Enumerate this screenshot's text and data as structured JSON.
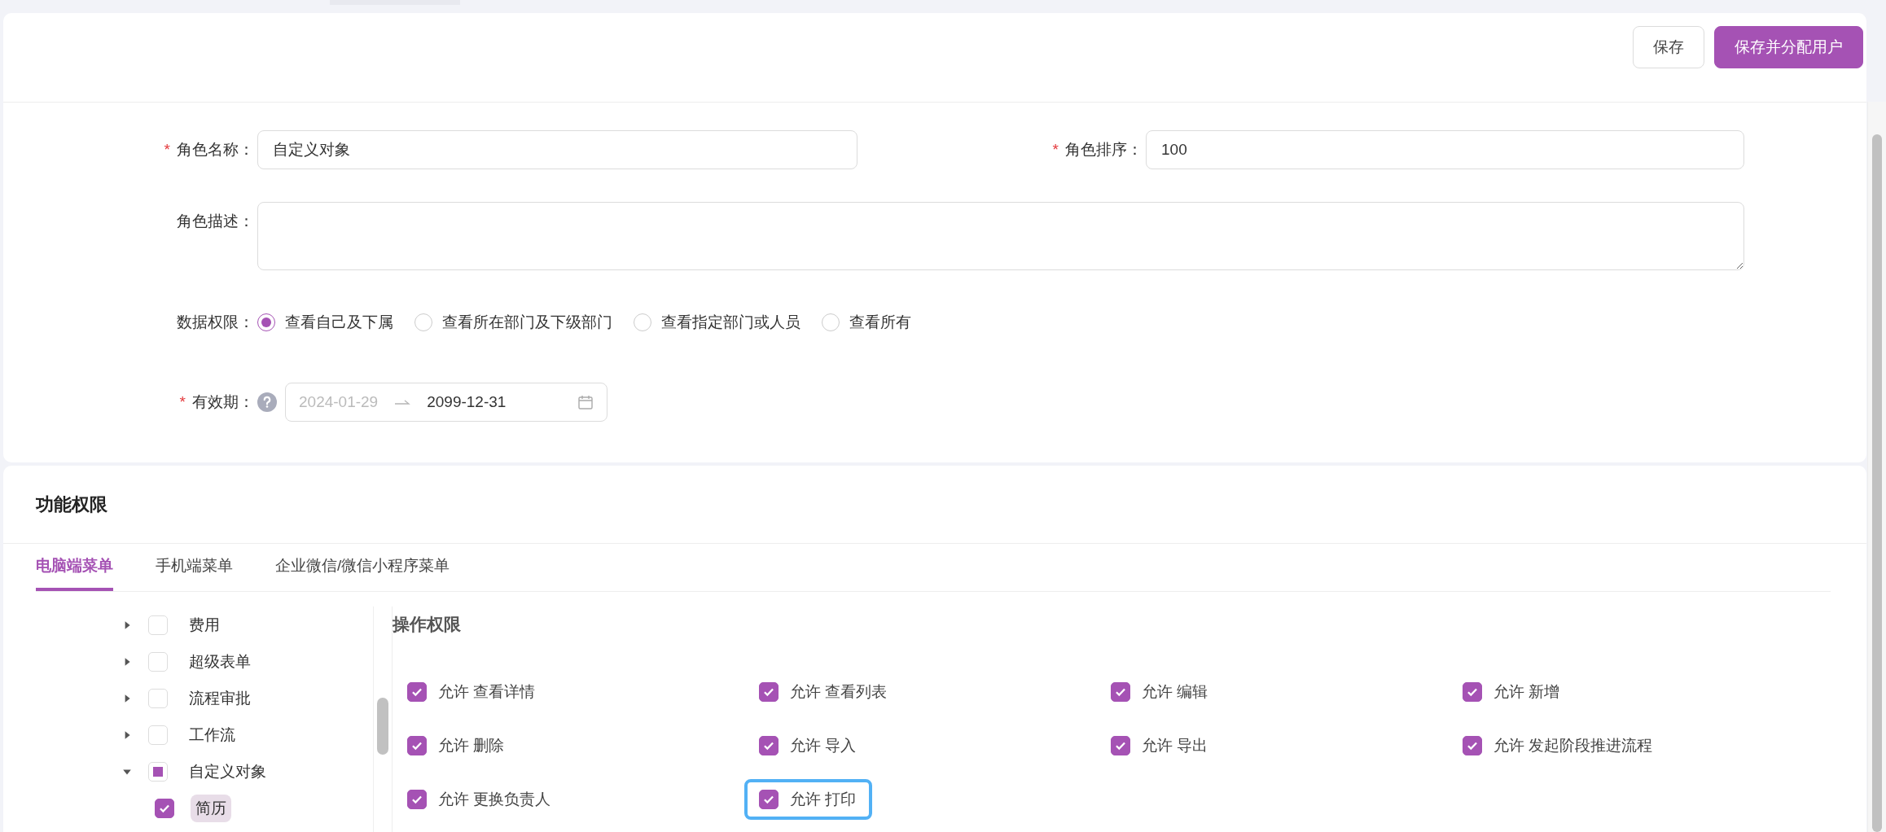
{
  "header": {
    "buttons": [
      {
        "label": "保存",
        "kind": "secondary"
      },
      {
        "label": "保存并分配用户",
        "kind": "primary"
      }
    ]
  },
  "form": {
    "name": {
      "label": "角色名称：",
      "required_mark": "*",
      "value": "自定义对象"
    },
    "sort": {
      "label": "角色排序：",
      "required_mark": "*",
      "value": "100"
    },
    "description": {
      "label": "角色描述："
    },
    "data_scope": {
      "label": "数据权限：",
      "options": [
        {
          "label": "查看自己及下属",
          "selected": true
        },
        {
          "label": "查看所在部门及下级部门",
          "selected": false
        },
        {
          "label": "查看指定部门或人员",
          "selected": false
        },
        {
          "label": "查看所有",
          "selected": false
        }
      ]
    },
    "validity": {
      "label": "有效期：",
      "required_mark": "*",
      "start": "2024-01-29",
      "start_disabled": true,
      "end": "2099-12-31"
    }
  },
  "function_permissions": {
    "title": "功能权限",
    "tabs": [
      {
        "label": "电脑端菜单",
        "selected": true
      },
      {
        "label": "手机端菜单",
        "selected": false
      },
      {
        "label": "企业微信/微信小程序菜单",
        "selected": false
      }
    ],
    "tree": [
      {
        "label": "费用",
        "expanded": false,
        "checked": false,
        "indeterminate": false
      },
      {
        "label": "超级表单",
        "expanded": false,
        "checked": false,
        "indeterminate": false
      },
      {
        "label": "流程审批",
        "expanded": false,
        "checked": false,
        "indeterminate": false
      },
      {
        "label": "工作流",
        "expanded": false,
        "checked": false,
        "indeterminate": false
      },
      {
        "label": "自定义对象",
        "expanded": true,
        "checked": false,
        "indeterminate": true,
        "children": [
          {
            "label": "简历",
            "checked": true,
            "selected": true
          }
        ]
      }
    ],
    "operations": {
      "title": "操作权限",
      "items": [
        {
          "label": "允许 查看详情",
          "checked": true,
          "focused": false
        },
        {
          "label": "允许 查看列表",
          "checked": true,
          "focused": false
        },
        {
          "label": "允许 编辑",
          "checked": true,
          "focused": false
        },
        {
          "label": "允许 新增",
          "checked": true,
          "focused": false
        },
        {
          "label": "允许 删除",
          "checked": true,
          "focused": false
        },
        {
          "label": "允许 导入",
          "checked": true,
          "focused": false
        },
        {
          "label": "允许 导出",
          "checked": true,
          "focused": false
        },
        {
          "label": "允许 发起阶段推进流程",
          "checked": true,
          "focused": false
        },
        {
          "label": "允许 更换负责人",
          "checked": true,
          "focused": false
        },
        {
          "label": "允许 打印",
          "checked": true,
          "focused": true
        }
      ]
    }
  }
}
